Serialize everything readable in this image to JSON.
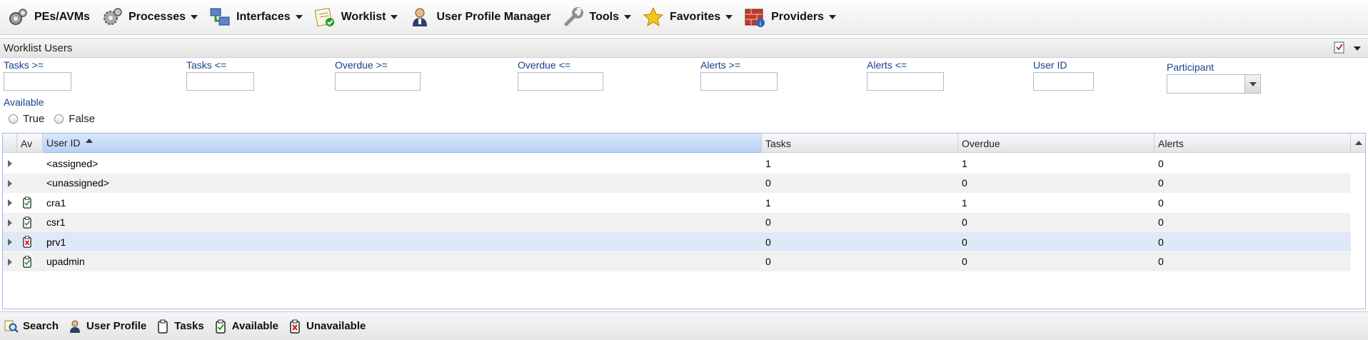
{
  "menubar": {
    "items": [
      {
        "label": "PEs/AVMs",
        "icon": "gears-icon",
        "has_dropdown": false
      },
      {
        "label": "Processes",
        "icon": "gears-icon",
        "has_dropdown": true
      },
      {
        "label": "Interfaces",
        "icon": "network-icon",
        "has_dropdown": true
      },
      {
        "label": "Worklist",
        "icon": "checklist-icon",
        "has_dropdown": true
      },
      {
        "label": "User Profile Manager",
        "icon": "user-icon",
        "has_dropdown": false
      },
      {
        "label": "Tools",
        "icon": "wrench-icon",
        "has_dropdown": true
      },
      {
        "label": "Favorites",
        "icon": "star-icon",
        "has_dropdown": true
      },
      {
        "label": "Providers",
        "icon": "firewall-icon",
        "has_dropdown": true
      }
    ]
  },
  "panel": {
    "title": "Worklist Users"
  },
  "filters": {
    "tasks_gte": {
      "label": "Tasks >=",
      "value": ""
    },
    "tasks_lte": {
      "label": "Tasks <=",
      "value": ""
    },
    "overdue_gte": {
      "label": "Overdue >=",
      "value": ""
    },
    "overdue_lte": {
      "label": "Overdue <=",
      "value": ""
    },
    "alerts_gte": {
      "label": "Alerts >=",
      "value": ""
    },
    "alerts_lte": {
      "label": "Alerts <=",
      "value": ""
    },
    "user_id": {
      "label": "User ID",
      "value": ""
    },
    "participant": {
      "label": "Participant",
      "value": ""
    },
    "available": {
      "label": "Available",
      "options": [
        "True",
        "False"
      ]
    }
  },
  "grid": {
    "columns": [
      "",
      "Av",
      "User ID",
      "Tasks",
      "Overdue",
      "Alerts"
    ],
    "sorted_column": "User ID",
    "sort_direction": "ascending",
    "rows": [
      {
        "availability": "none",
        "user_id": "<assigned>",
        "tasks": "1",
        "overdue": "1",
        "alerts": "0"
      },
      {
        "availability": "none",
        "user_id": "<unassigned>",
        "tasks": "0",
        "overdue": "0",
        "alerts": "0"
      },
      {
        "availability": "available",
        "user_id": "cra1",
        "tasks": "1",
        "overdue": "1",
        "alerts": "0"
      },
      {
        "availability": "available",
        "user_id": "csr1",
        "tasks": "0",
        "overdue": "0",
        "alerts": "0"
      },
      {
        "availability": "unavailable",
        "user_id": "prv1",
        "tasks": "0",
        "overdue": "0",
        "alerts": "0",
        "selected": true
      },
      {
        "availability": "available",
        "user_id": "upadmin",
        "tasks": "0",
        "overdue": "0",
        "alerts": "0"
      }
    ]
  },
  "legend": {
    "items": [
      {
        "label": "Search",
        "icon": "search-icon"
      },
      {
        "label": "User Profile",
        "icon": "user-icon"
      },
      {
        "label": "Tasks",
        "icon": "clipboard-icon"
      },
      {
        "label": "Available",
        "icon": "available-icon"
      },
      {
        "label": "Unavailable",
        "icon": "unavailable-icon"
      }
    ]
  },
  "colors": {
    "label_blue": "#15428b",
    "available_green": "#2a9a2a",
    "unavailable_red": "#cc2222",
    "sorted_header": "#b6d2f5",
    "selected_row": "#dfe8f6"
  }
}
